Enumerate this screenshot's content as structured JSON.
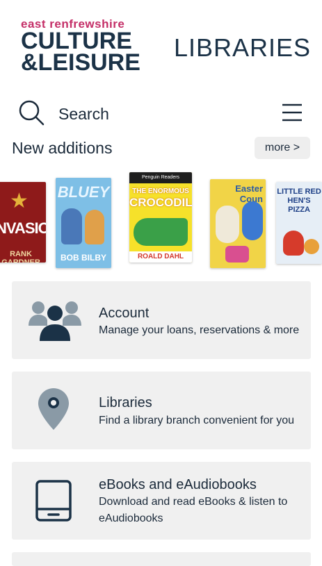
{
  "header": {
    "logo_line1": "east renfrewshire",
    "logo_line2": "CULTURE",
    "logo_line3": "&LEISURE",
    "title": "LIBRARIES",
    "colors": {
      "brand_pink": "#c42e67",
      "brand_navy": "#1b3247"
    }
  },
  "search": {
    "placeholder": "Search",
    "icon": "search-icon",
    "menu_icon": "hamburger-menu-icon"
  },
  "new_additions": {
    "title": "New additions",
    "more_label": "more >",
    "books": [
      {
        "title": "NVASION",
        "author": "RANK GARDNER"
      },
      {
        "title": "BLUEY",
        "author": "BOB BILBY"
      },
      {
        "series": "Penguin Readers",
        "title_small": "THE ENORMOUS",
        "title_big": "CROCODILE",
        "author": "ROALD DAHL"
      },
      {
        "title": "Easter Coun",
        "author": ""
      },
      {
        "title": "LITTLE RED HEN'S PIZZA",
        "author": ""
      }
    ]
  },
  "cards": [
    {
      "title": "Account",
      "description": "Manage your loans, reservations & more",
      "icon": "users-icon"
    },
    {
      "title": "Libraries",
      "description": "Find a library branch convenient for you",
      "icon": "location-pin-icon"
    },
    {
      "title": "eBooks and eAudiobooks",
      "description": "Download and read eBooks & listen to eAudiobooks",
      "icon": "tablet-icon"
    }
  ]
}
